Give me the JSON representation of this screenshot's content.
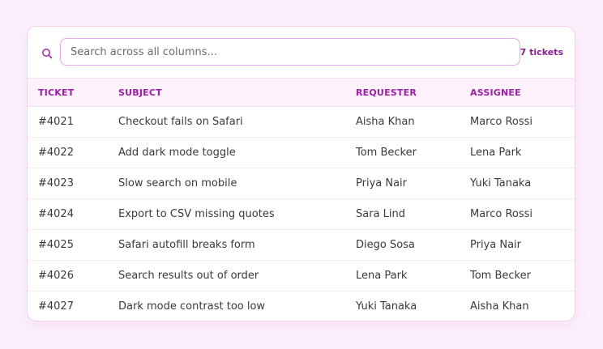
{
  "search": {
    "placeholder": "Search across all columns...",
    "count_label": "7 tickets"
  },
  "table": {
    "headers": [
      "TICKET",
      "SUBJECT",
      "REQUESTER",
      "ASSIGNEE"
    ],
    "rows": [
      [
        "#4021",
        "Checkout fails on Safari",
        "Aisha Khan",
        "Marco Rossi"
      ],
      [
        "#4022",
        "Add dark mode toggle",
        "Tom Becker",
        "Lena Park"
      ],
      [
        "#4023",
        "Slow search on mobile",
        "Priya Nair",
        "Yuki Tanaka"
      ],
      [
        "#4024",
        "Export to CSV missing quotes",
        "Sara Lind",
        "Marco Rossi"
      ],
      [
        "#4025",
        "Safari autofill breaks form",
        "Diego Sosa",
        "Priya Nair"
      ],
      [
        "#4026",
        "Search results out of order",
        "Lena Park",
        "Tom Becker"
      ],
      [
        "#4027",
        "Dark mode contrast too low",
        "Yuki Tanaka",
        "Aisha Khan"
      ]
    ]
  },
  "colors": {
    "accent": "#9b1fa3",
    "background": "#fcf0fc"
  },
  "icons": {
    "search": "search-icon"
  }
}
